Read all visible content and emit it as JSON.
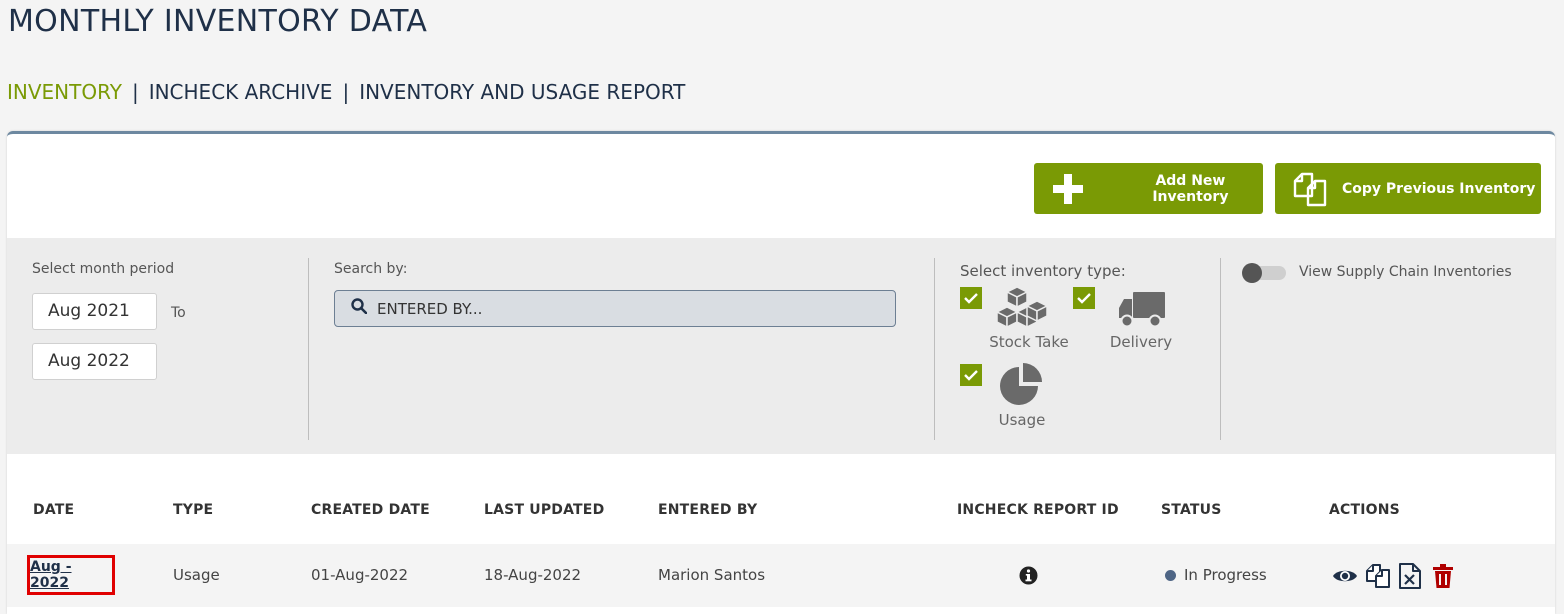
{
  "page": {
    "title": "MONTHLY INVENTORY DATA"
  },
  "nav": {
    "items": [
      {
        "label": "INVENTORY",
        "active": true
      },
      {
        "label": "INCHECK ARCHIVE",
        "active": false
      },
      {
        "label": "INVENTORY AND USAGE REPORT",
        "active": false
      }
    ],
    "separator": "|"
  },
  "toolbar": {
    "add_label": "Add New Inventory",
    "copy_label": "Copy Previous Inventory"
  },
  "filters": {
    "month_label": "Select month period",
    "from": "Aug 2021",
    "to_label": "To",
    "to": "Aug 2022",
    "search_label": "Search by:",
    "search_placeholder": "ENTERED BY...",
    "type_label": "Select inventory type:",
    "types": [
      {
        "label": "Stock Take",
        "checked": true,
        "icon": "boxes-icon"
      },
      {
        "label": "Delivery",
        "checked": true,
        "icon": "truck-icon"
      },
      {
        "label": "Usage",
        "checked": true,
        "icon": "pie-chart-icon"
      }
    ],
    "supply_chain_label": "View Supply Chain Inventories",
    "supply_chain_on": false
  },
  "table": {
    "headers": [
      "DATE",
      "TYPE",
      "CREATED DATE",
      "LAST UPDATED",
      "ENTERED BY",
      "INCHECK REPORT ID",
      "STATUS",
      "ACTIONS"
    ],
    "rows": [
      {
        "date": "Aug - 2022",
        "type": "Usage",
        "created": "01-Aug-2022",
        "updated": "18-Aug-2022",
        "entered_by": "Marion Santos",
        "report_icon": "info-icon",
        "status": "In Progress",
        "actions": [
          "view-icon",
          "copy-icon",
          "excel-icon",
          "delete-icon"
        ]
      }
    ]
  },
  "colors": {
    "accent": "#7a9a05",
    "title": "#1f3048",
    "status_dot": "#4e6585",
    "delete": "#b00000",
    "highlight_border": "#e00000"
  }
}
